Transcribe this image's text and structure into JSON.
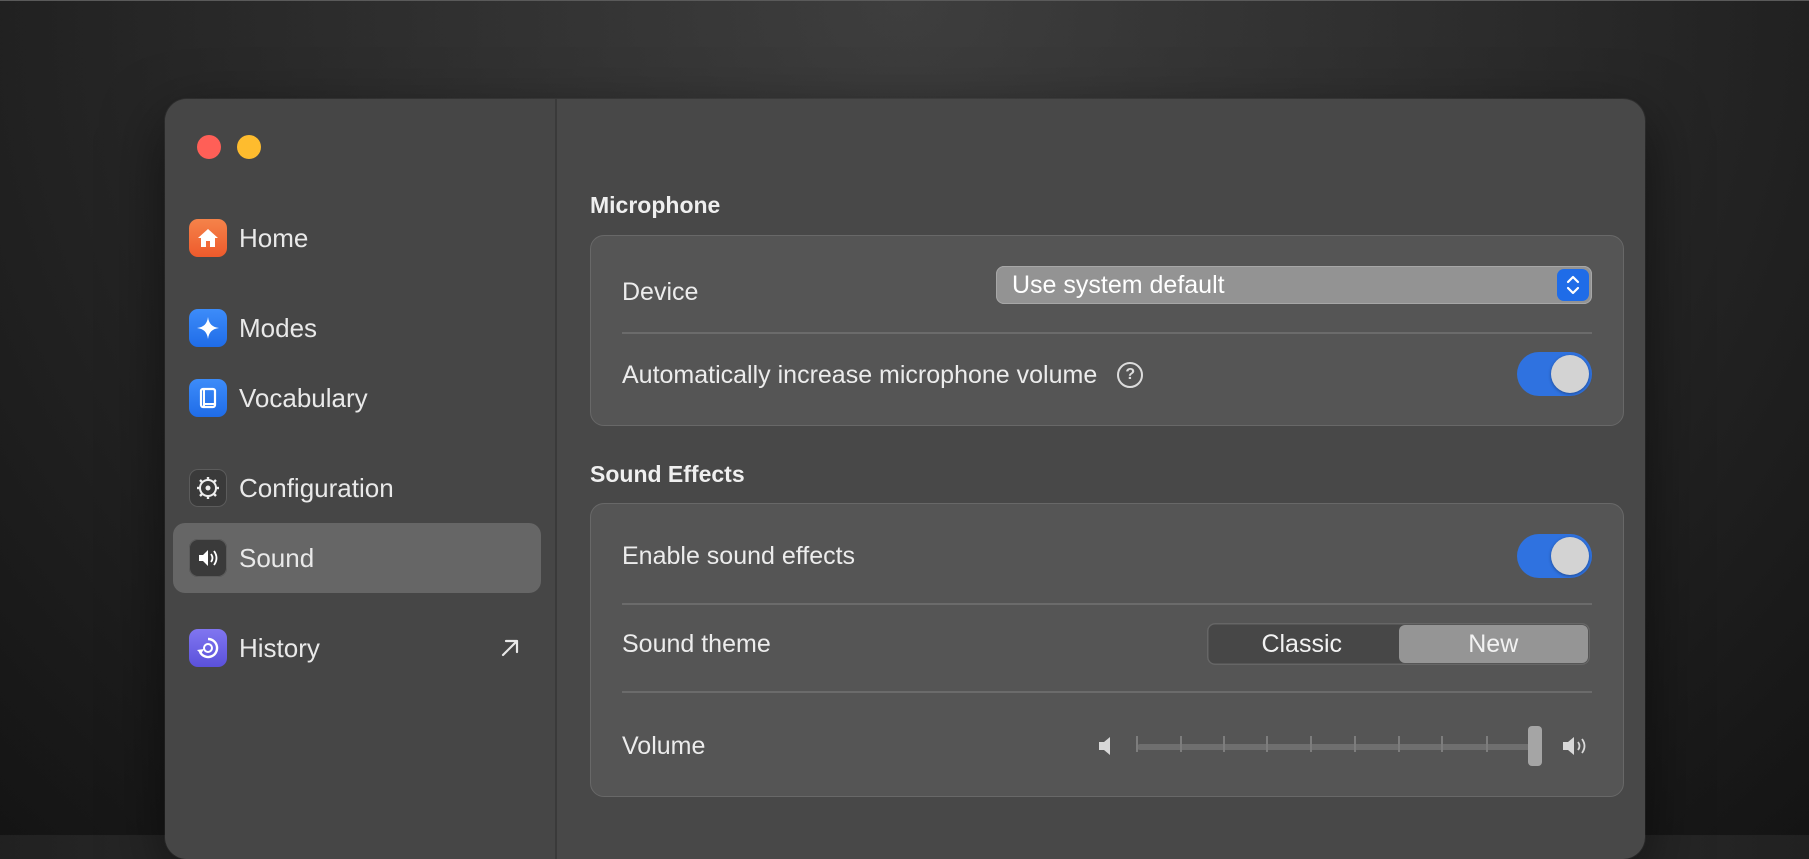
{
  "sidebar": {
    "items": [
      {
        "label": "Home",
        "icon": "home-icon",
        "color": "#f26b3a"
      },
      {
        "label": "Modes",
        "icon": "sparkle-icon",
        "color": "#2f7cf6"
      },
      {
        "label": "Vocabulary",
        "icon": "book-icon",
        "color": "#2f7cf6"
      },
      {
        "label": "Configuration",
        "icon": "gear-icon",
        "color": "#3a3a3a"
      },
      {
        "label": "Sound",
        "icon": "speaker-icon",
        "color": "#3a3a3a",
        "active": true
      },
      {
        "label": "History",
        "icon": "history-icon",
        "color": "#6e63e6",
        "external": true
      }
    ]
  },
  "microphone": {
    "title": "Microphone",
    "device_label": "Device",
    "device_value": "Use system default",
    "auto_volume_label": "Automatically increase microphone volume",
    "auto_volume_on": true
  },
  "sound_effects": {
    "title": "Sound Effects",
    "enable_label": "Enable sound effects",
    "enable_on": true,
    "theme_label": "Sound theme",
    "theme_options": [
      "Classic",
      "New"
    ],
    "theme_selected": "New",
    "volume_label": "Volume",
    "volume_level": 1.0
  },
  "colors": {
    "accent": "#2f72e0",
    "window_bg": "#484848",
    "card_bg": "#555555"
  }
}
